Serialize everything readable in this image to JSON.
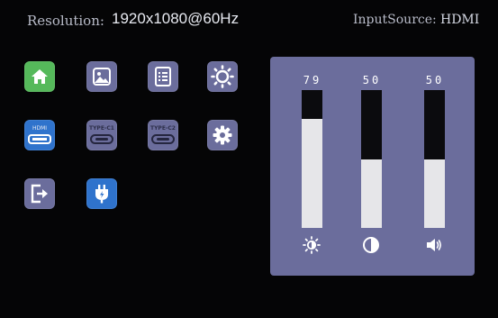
{
  "header": {
    "resolution_label": "Resolution:",
    "resolution_value": "1920x1080@60Hz",
    "input_source_label": "InputSource:",
    "input_source_value": "HDMI"
  },
  "menu": {
    "items": [
      {
        "icon": "home-icon",
        "selected": true
      },
      {
        "icon": "image-icon"
      },
      {
        "icon": "document-icon"
      },
      {
        "icon": "brightness-icon"
      },
      {
        "icon": "hdmi-port-icon",
        "label": "HDMI"
      },
      {
        "icon": "type-c-port-icon",
        "label": "TYPE-C1"
      },
      {
        "icon": "type-c-port-icon",
        "label": "TYPE-C2"
      },
      {
        "icon": "gear-icon"
      },
      {
        "icon": "exit-icon"
      },
      {
        "icon": "power-plug-icon"
      }
    ]
  },
  "adjust_panel": {
    "sliders": [
      {
        "id": "brightness",
        "value": "79",
        "level": 0.79,
        "icon": "brightness-icon"
      },
      {
        "id": "contrast",
        "value": "50",
        "level": 0.5,
        "icon": "contrast-icon"
      },
      {
        "id": "volume",
        "value": "50",
        "level": 0.5,
        "icon": "volume-icon"
      }
    ]
  },
  "colors": {
    "background": "#050506",
    "tile": "#6b6d9c",
    "home_tile": "#55b95a",
    "blue_tile": "#2f73cc",
    "bar_fill": "#e6e6e9"
  }
}
